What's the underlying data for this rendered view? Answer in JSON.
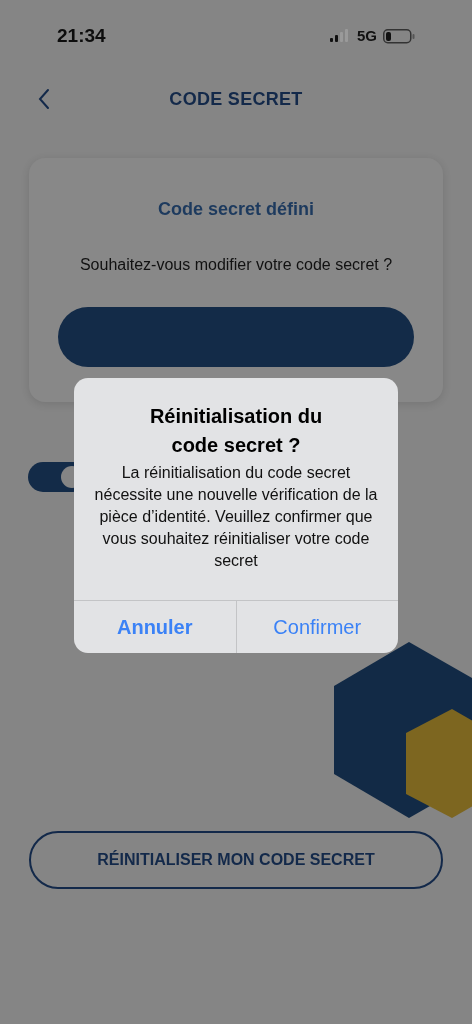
{
  "status_bar": {
    "time": "21:34",
    "network": "5G"
  },
  "header": {
    "title": "CODE SECRET"
  },
  "card": {
    "title": "Code secret défini",
    "question": "Souhaitez-vous modifier votre code secret ?"
  },
  "toggle": {
    "on": true
  },
  "reset_button": {
    "label": "RÉINITIALISER MON CODE SECRET"
  },
  "dialog": {
    "title": "Réinitialisation du code secret ?",
    "message": "La réinitialisation du code secret nécessite une nouvelle vérification de la pièce d’identité. Veuillez confirmer que vous souhaitez réinitialiser votre code secret",
    "buttons": [
      {
        "label": "Annuler",
        "kind": "cancel"
      },
      {
        "label": "Confirmer",
        "kind": "default"
      }
    ]
  }
}
